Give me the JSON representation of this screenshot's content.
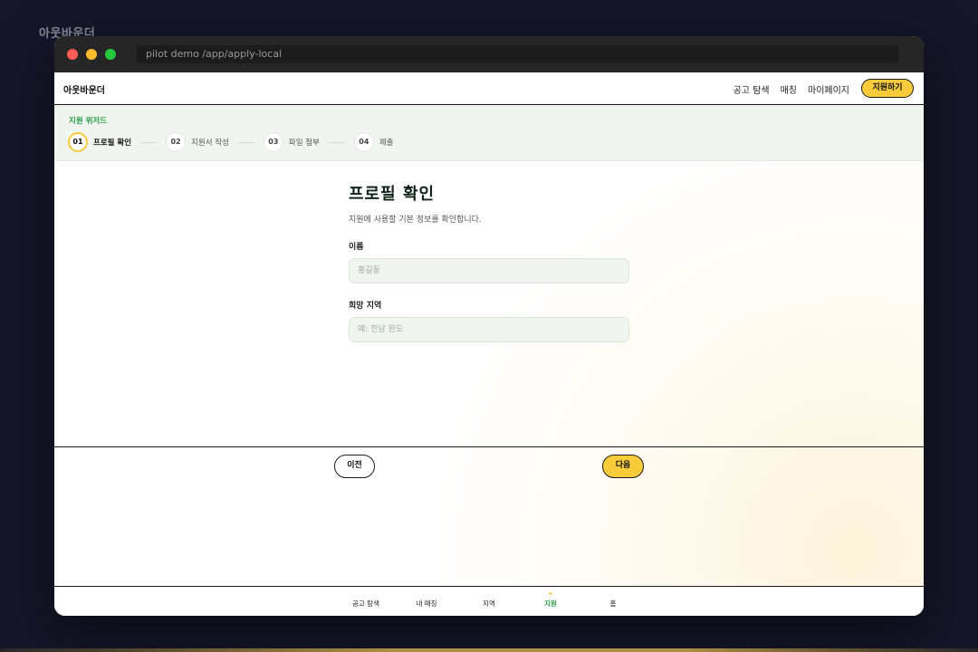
{
  "brand": "아웃바운더",
  "browser": {
    "url": "pilot demo /app/apply-local"
  },
  "navbar": {
    "logo": "아웃바운더",
    "links": [
      "공고 탐색",
      "매칭",
      "마이페이지"
    ],
    "cta": "지원하기"
  },
  "wizard": {
    "title": "지원 위저드",
    "steps": [
      {
        "num": "01",
        "label": "프로필 확인",
        "active": true
      },
      {
        "num": "02",
        "label": "지원서 작성",
        "active": false
      },
      {
        "num": "03",
        "label": "파일 첨부",
        "active": false
      },
      {
        "num": "04",
        "label": "제출",
        "active": false
      }
    ]
  },
  "form": {
    "title": "프로필 확인",
    "subtitle": "지원에 사용할 기본 정보를 확인합니다.",
    "fields": [
      {
        "label": "이름",
        "placeholder": "홍길동",
        "value": ""
      },
      {
        "label": "희망 지역",
        "placeholder": "예: 전남 완도",
        "value": ""
      }
    ]
  },
  "actions": {
    "prev": "이전",
    "next": "다음"
  },
  "tabbar": {
    "items": [
      {
        "label": "공고 탐색",
        "active": false
      },
      {
        "label": "내 매칭",
        "active": false
      },
      {
        "label": "지역",
        "active": false
      },
      {
        "label": "지원",
        "active": true
      },
      {
        "label": "홈",
        "active": false
      }
    ]
  },
  "colors": {
    "accent": "#f7cb3a",
    "brand_green": "#2a9d4a",
    "background": "#151628"
  }
}
